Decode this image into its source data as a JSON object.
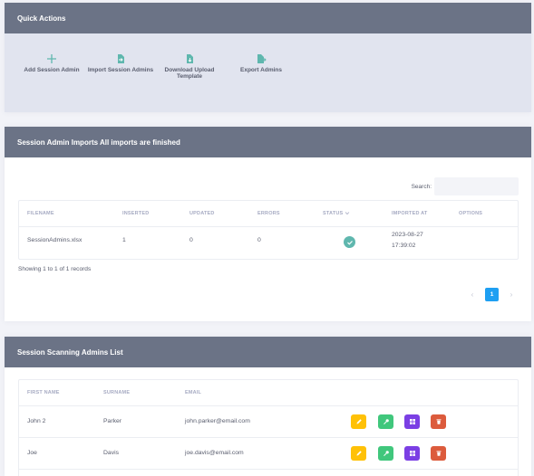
{
  "quick_actions": {
    "title": "Quick Actions",
    "buttons": [
      {
        "label": "Add Session Admin",
        "icon": "plus-icon"
      },
      {
        "label": "Import Session Admins",
        "icon": "file-import-icon"
      },
      {
        "label": "Download Upload Template",
        "icon": "file-download-icon"
      },
      {
        "label": "Export Admins",
        "icon": "file-export-icon"
      }
    ],
    "accent": "#5fb7ae"
  },
  "imports": {
    "title": "Session Admin Imports All imports are finished",
    "search_label": "Search:",
    "search_value": "",
    "columns": [
      "FILENAME",
      "INSERTED",
      "UPDATED",
      "ERRORS",
      "STATUS",
      "IMPORTED AT",
      "OPTIONS"
    ],
    "rows": [
      {
        "filename": "SessionAdmins.xlsx",
        "inserted": "1",
        "updated": "0",
        "errors": "0",
        "status": "finished",
        "imported_date": "2023-08-27",
        "imported_time": "17:39:02",
        "options": ""
      }
    ],
    "info": "Showing 1 to 1 of 1 records",
    "pagination": {
      "prev": "‹",
      "current": "1",
      "next": "›"
    }
  },
  "admins": {
    "title": "Session Scanning Admins List",
    "columns": [
      "FIRST NAME",
      "SURNAME",
      "EMAIL"
    ],
    "rows": [
      {
        "first_name": "John 2",
        "surname": "Parker",
        "email": "john.parker@email.com"
      },
      {
        "first_name": "Joe",
        "surname": "Davis",
        "email": "joe.davis@email.com"
      }
    ],
    "action_icons": [
      "pencil-icon",
      "key-icon",
      "grid-icon",
      "trash-icon"
    ],
    "action_colors": {
      "edit": "#ffc107",
      "key": "#40c77c",
      "grid": "#7b3fe4",
      "delete": "#dc5b3c"
    }
  },
  "colors": {
    "header_bg": "#6b7386",
    "page_bg": "#f2f3f8",
    "primary": "#1e9ff2"
  }
}
